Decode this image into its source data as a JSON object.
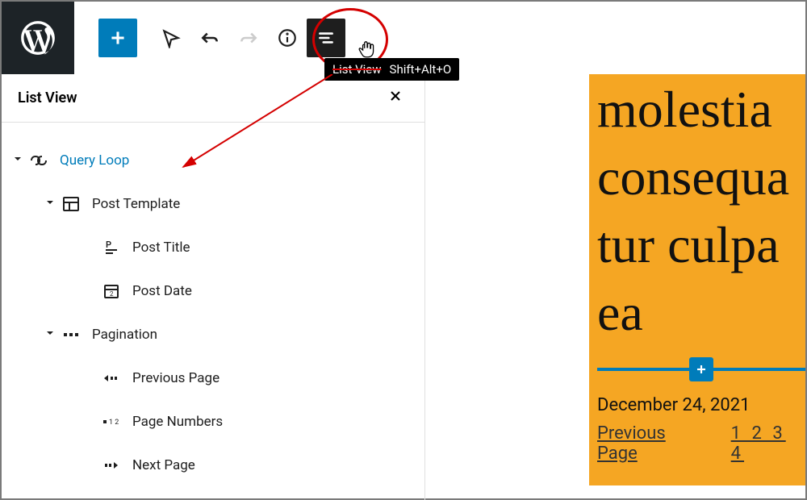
{
  "toolbar": {
    "tooltip_label": "List View",
    "tooltip_shortcut": "Shift+Alt+O"
  },
  "sidebar": {
    "title": "List View",
    "tree": {
      "query_loop": "Query Loop",
      "post_template": "Post Template",
      "post_title": "Post Title",
      "post_date": "Post Date",
      "pagination": "Pagination",
      "previous_page": "Previous Page",
      "page_numbers": "Page Numbers",
      "next_page": "Next Page"
    }
  },
  "canvas": {
    "title_lines": [
      "molestia",
      "consequa",
      "tur culpa",
      "ea"
    ],
    "post_date": "December 24, 2021",
    "pagination": {
      "prev": "Previous Page",
      "pages": "1 2 3 4"
    }
  }
}
